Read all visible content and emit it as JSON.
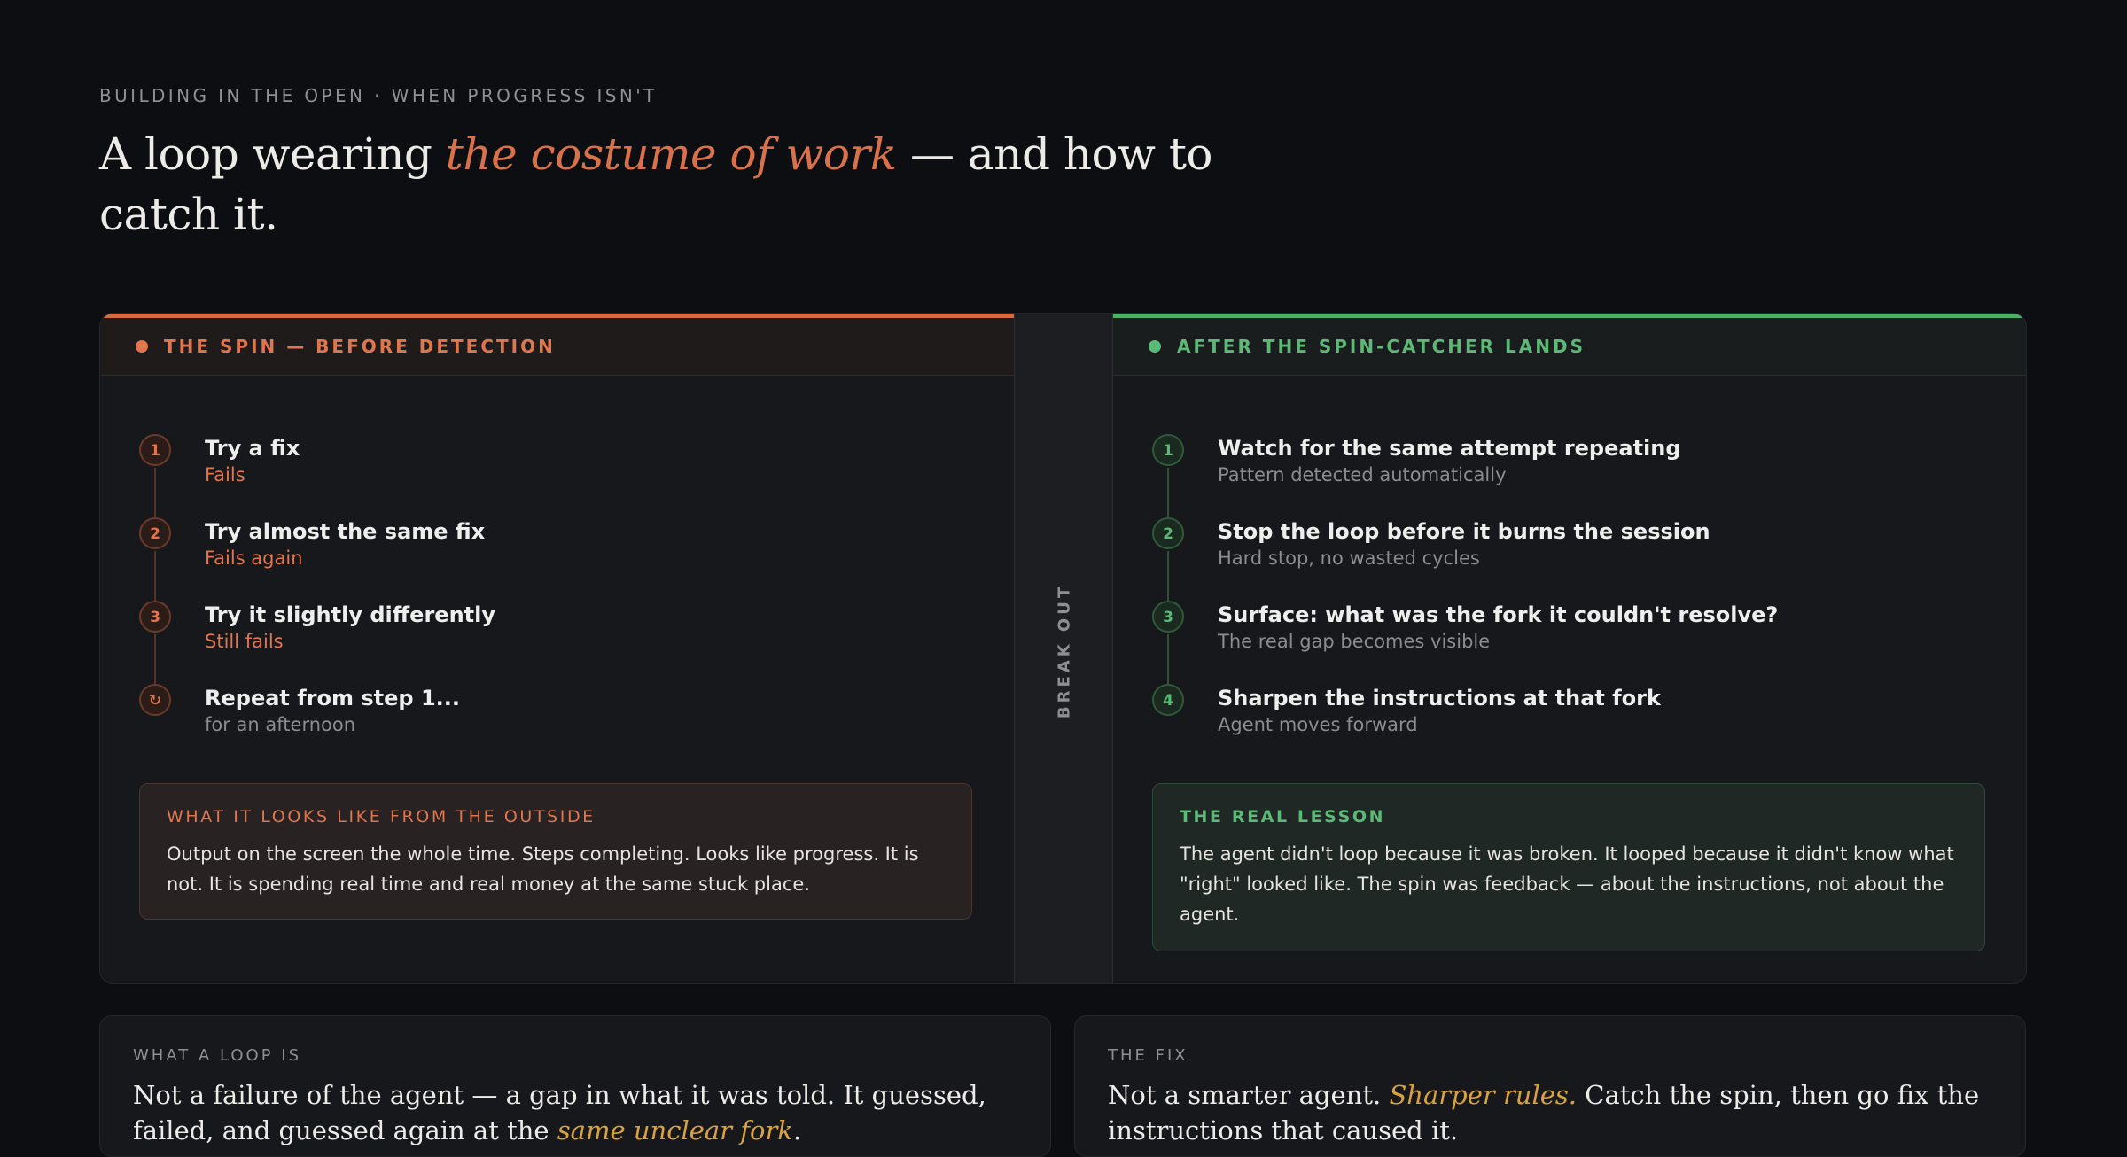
{
  "eyebrow": "BUILDING IN THE OPEN · WHEN PROGRESS ISN'T",
  "headline": {
    "before": "A loop wearing ",
    "emphasis": "the costume of work",
    "after": " — and how to catch it."
  },
  "spin": {
    "title": "THE SPIN — BEFORE DETECTION",
    "steps": [
      {
        "marker": "1",
        "title": "Try a fix",
        "sub": "Fails"
      },
      {
        "marker": "2",
        "title": "Try almost the same fix",
        "sub": "Fails again"
      },
      {
        "marker": "3",
        "title": "Try it slightly differently",
        "sub": "Still fails"
      },
      {
        "marker": "↻",
        "title": "Repeat from step 1...",
        "sub": "for an afternoon"
      }
    ],
    "callout": {
      "title": "WHAT IT LOOKS LIKE FROM THE OUTSIDE",
      "body": "Output on the screen the whole time. Steps completing. Looks like progress. It is not. It is spending real time and real money at the same stuck place."
    }
  },
  "breakout_label": "BREAK OUT",
  "after": {
    "title": "AFTER THE SPIN-CATCHER LANDS",
    "steps": [
      {
        "marker": "1",
        "title": "Watch for the same attempt repeating",
        "sub": "Pattern detected automatically"
      },
      {
        "marker": "2",
        "title": "Stop the loop before it burns the session",
        "sub": "Hard stop, no wasted cycles"
      },
      {
        "marker": "3",
        "title": "Surface: what was the fork it couldn't resolve?",
        "sub": "The real gap becomes visible"
      },
      {
        "marker": "4",
        "title": "Sharpen the instructions at that fork",
        "sub": "Agent moves forward"
      }
    ],
    "callout": {
      "title": "THE REAL LESSON",
      "body": "The agent didn't loop because it was broken. It looped because it didn't know what \"right\" looked like. The spin was feedback — about the instructions, not about the agent."
    }
  },
  "cards": {
    "loop": {
      "title": "WHAT A LOOP IS",
      "body_before": "Not a failure of the agent — a gap in what it was told. It guessed, failed, and guessed again at the ",
      "body_emphasis": "same unclear fork",
      "body_after": "."
    },
    "fix": {
      "title": "THE FIX",
      "body_before": "Not a smarter agent. ",
      "body_emphasis": "Sharper rules.",
      "body_after": " Catch the spin, then go fix the instructions that caused it."
    }
  },
  "colors": {
    "background": "#0d0e11",
    "spin_accent": "#d86a42",
    "after_accent": "#4fae6a",
    "emphasis_gold": "#d9a23e"
  }
}
